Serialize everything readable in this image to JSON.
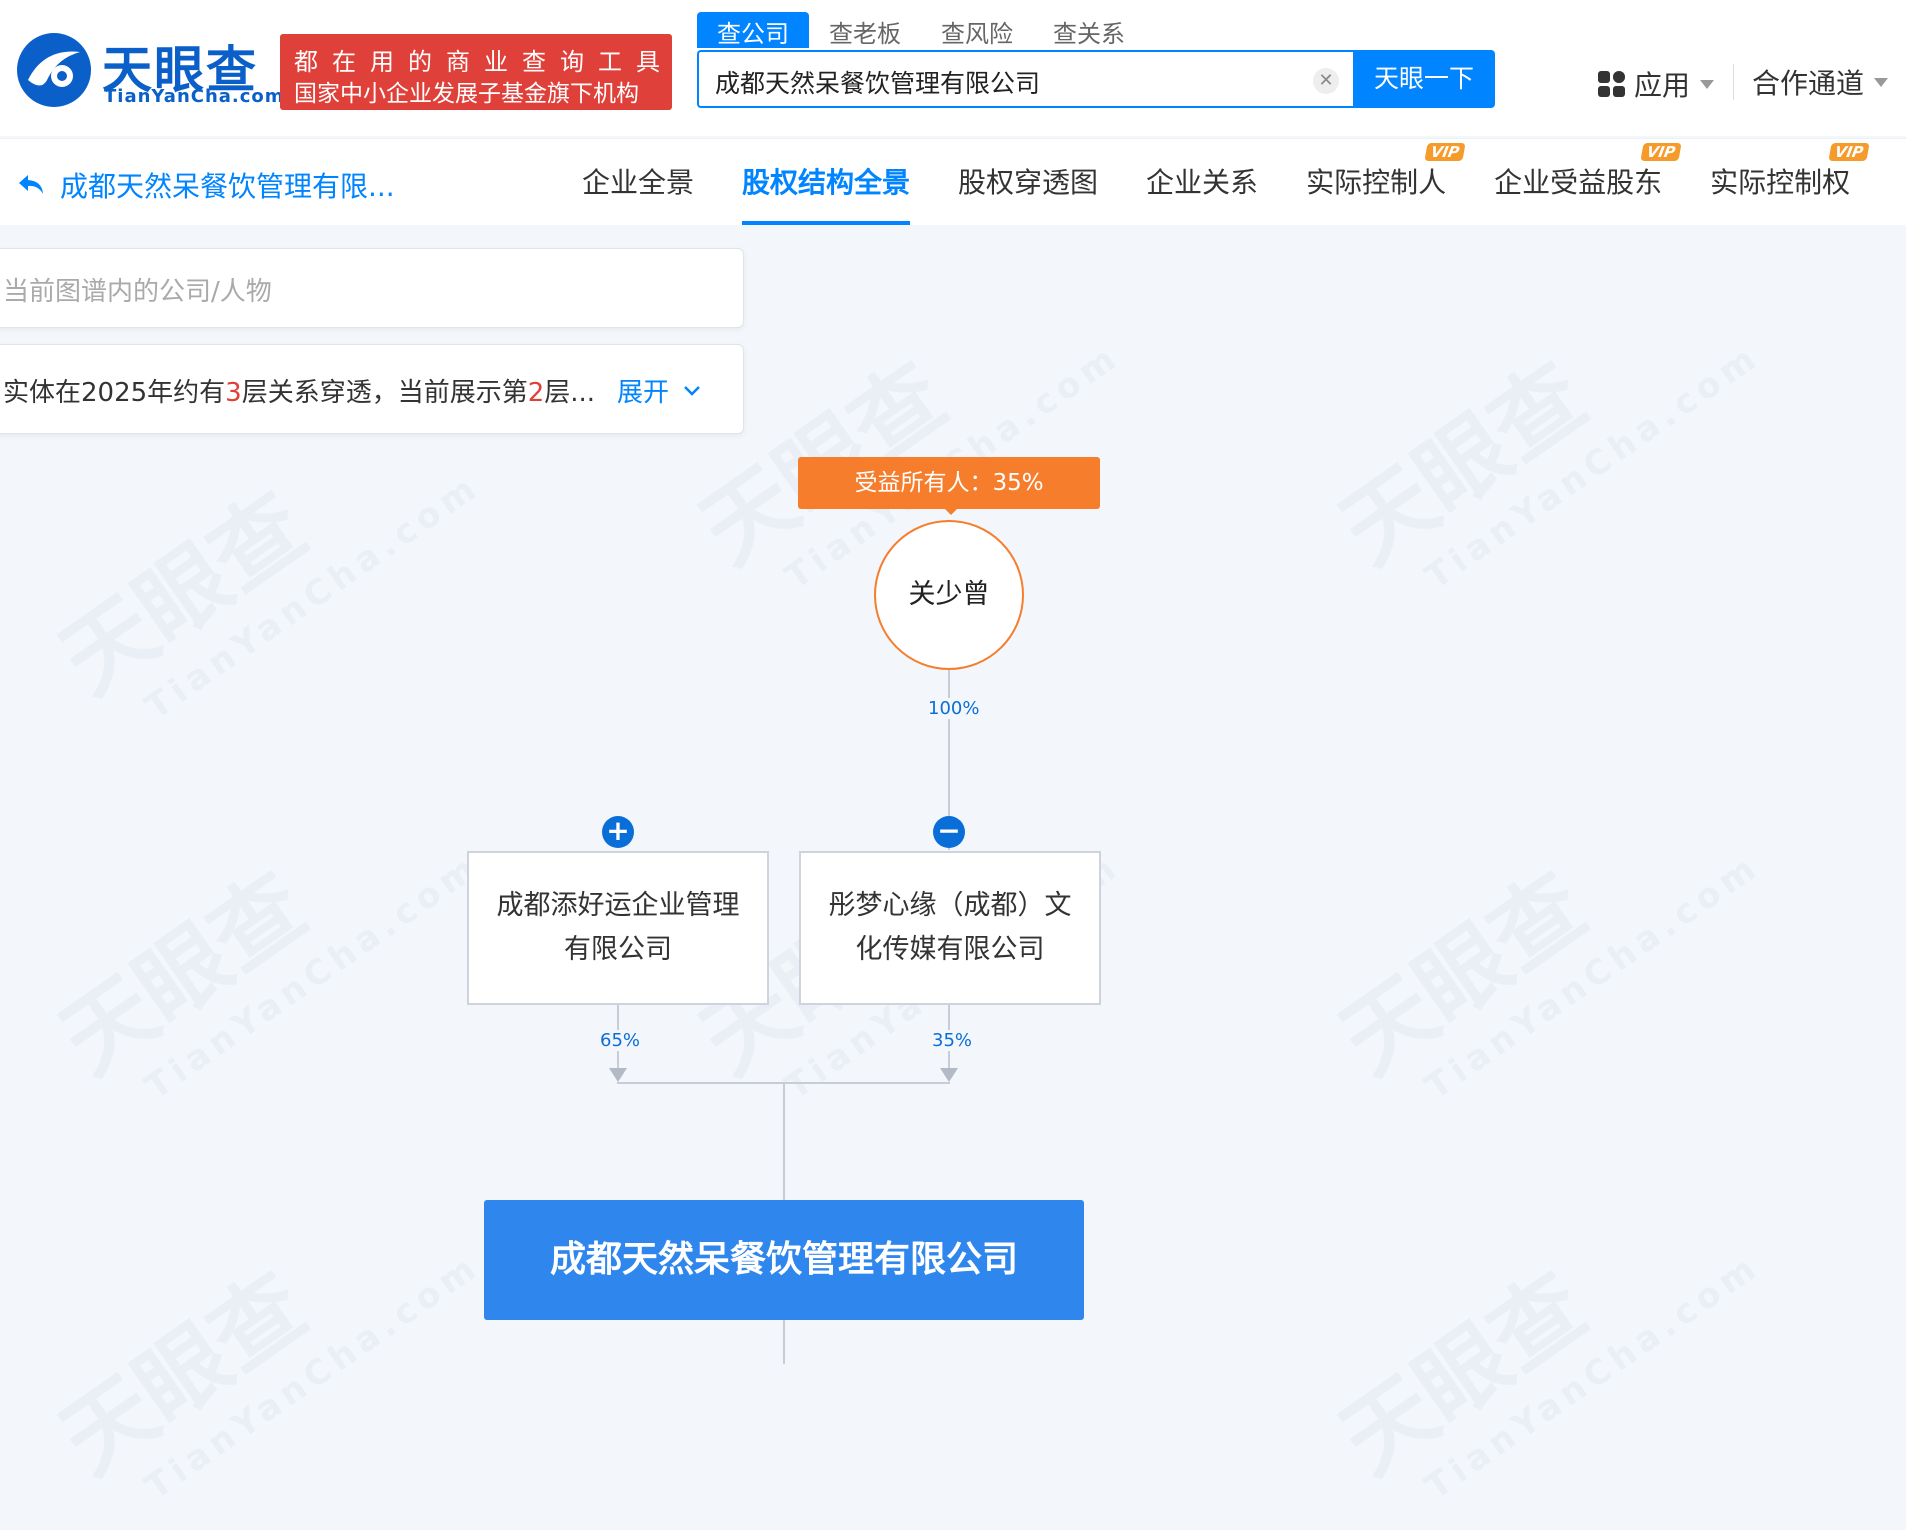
{
  "header": {
    "logo_cn": "天眼查",
    "logo_en": "TianYanCha.com",
    "slogan_line1": "都在用的商业查询工具",
    "slogan_line2": "国家中小企业发展子基金旗下机构",
    "search_tabs": [
      "查公司",
      "查老板",
      "查风险",
      "查关系"
    ],
    "search_value": "成都天然呆餐饮管理有限公司",
    "search_button": "天眼一下",
    "apps_label": "应用",
    "partner_label": "合作通道"
  },
  "subnav": {
    "back_title": "成都天然呆餐饮管理有限...",
    "tabs": [
      {
        "label": "企业全景",
        "vip": false
      },
      {
        "label": "股权结构全景",
        "vip": false
      },
      {
        "label": "股权穿透图",
        "vip": false
      },
      {
        "label": "企业关系",
        "vip": false
      },
      {
        "label": "实际控制人",
        "vip": true
      },
      {
        "label": "企业受益股东",
        "vip": true
      },
      {
        "label": "实际控制权",
        "vip": true
      }
    ],
    "vip_text": "VIP",
    "active_tab": "股权结构全景"
  },
  "panel": {
    "search_placeholder": "当前图谱内的公司/人物",
    "info_part1": "实体在2025年约有",
    "info_layers_total": "3",
    "info_part2": "层关系穿透，当前展示第",
    "info_layers_current": "2",
    "info_part3": "层...",
    "expand_label": "展开"
  },
  "watermark": {
    "cn": "天眼查",
    "en": "TianYanCha.com"
  },
  "graph": {
    "beneficiary_badge": "受益所有人：35%",
    "person_name": "关少曾",
    "person_to_company_pct": "100%",
    "company_left": "成都添好运企业管理有限公司",
    "company_right": "彤梦心缘（成都）文化传媒有限公司",
    "left_pct": "65%",
    "right_pct": "35%",
    "expand_symbol": "+",
    "collapse_symbol": "−",
    "main_company": "成都天然呆餐饮管理有限公司"
  },
  "colors": {
    "brand_blue": "#0084ff",
    "beneficiary_orange": "#f57d2c",
    "slogan_red": "#e0403a",
    "main_node_blue": "#2f86ec"
  }
}
